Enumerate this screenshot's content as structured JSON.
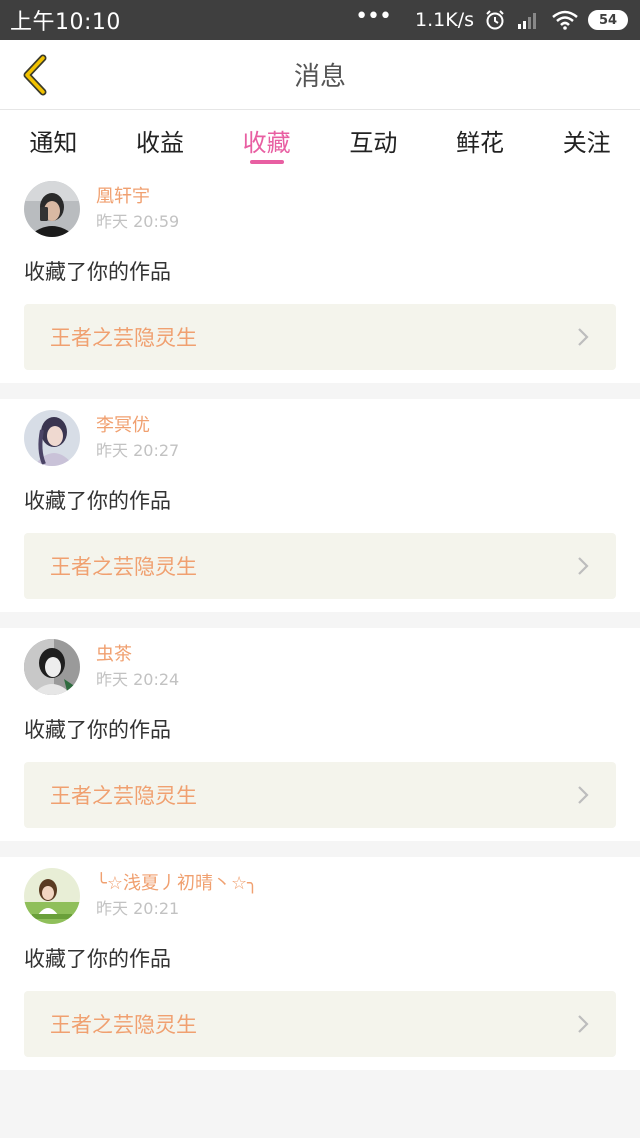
{
  "status_bar": {
    "time": "上午10:10",
    "dots": "•••",
    "net_speed": "1.1K/s",
    "battery": "54"
  },
  "header": {
    "title": "消息"
  },
  "tabs": [
    {
      "label": "通知",
      "active": false
    },
    {
      "label": "收益",
      "active": false
    },
    {
      "label": "收藏",
      "active": true
    },
    {
      "label": "互动",
      "active": false
    },
    {
      "label": "鲜花",
      "active": false
    },
    {
      "label": "关注",
      "active": false
    }
  ],
  "messages": [
    {
      "username": "凰轩宇",
      "time": "昨天 20:59",
      "action": "收藏了你的作品",
      "work_title": "王者之芸隐灵生"
    },
    {
      "username": "李冥优",
      "time": "昨天 20:27",
      "action": "收藏了你的作品",
      "work_title": "王者之芸隐灵生"
    },
    {
      "username": "虫茶",
      "time": "昨天 20:24",
      "action": "收藏了你的作品",
      "work_title": "王者之芸隐灵生"
    },
    {
      "username": "╰☆浅夏丿初晴丶☆╮",
      "time": "昨天 20:21",
      "action": "收藏了你的作品",
      "work_title": "王者之芸隐灵生"
    }
  ],
  "colors": {
    "accent": "#e85fa2",
    "name_orange": "#f0a070",
    "work_bg": "#f4f4ec",
    "back_arrow": "#f2c200"
  },
  "icons": {
    "back": "chevron-left-icon",
    "item": "chevron-right-icon"
  }
}
